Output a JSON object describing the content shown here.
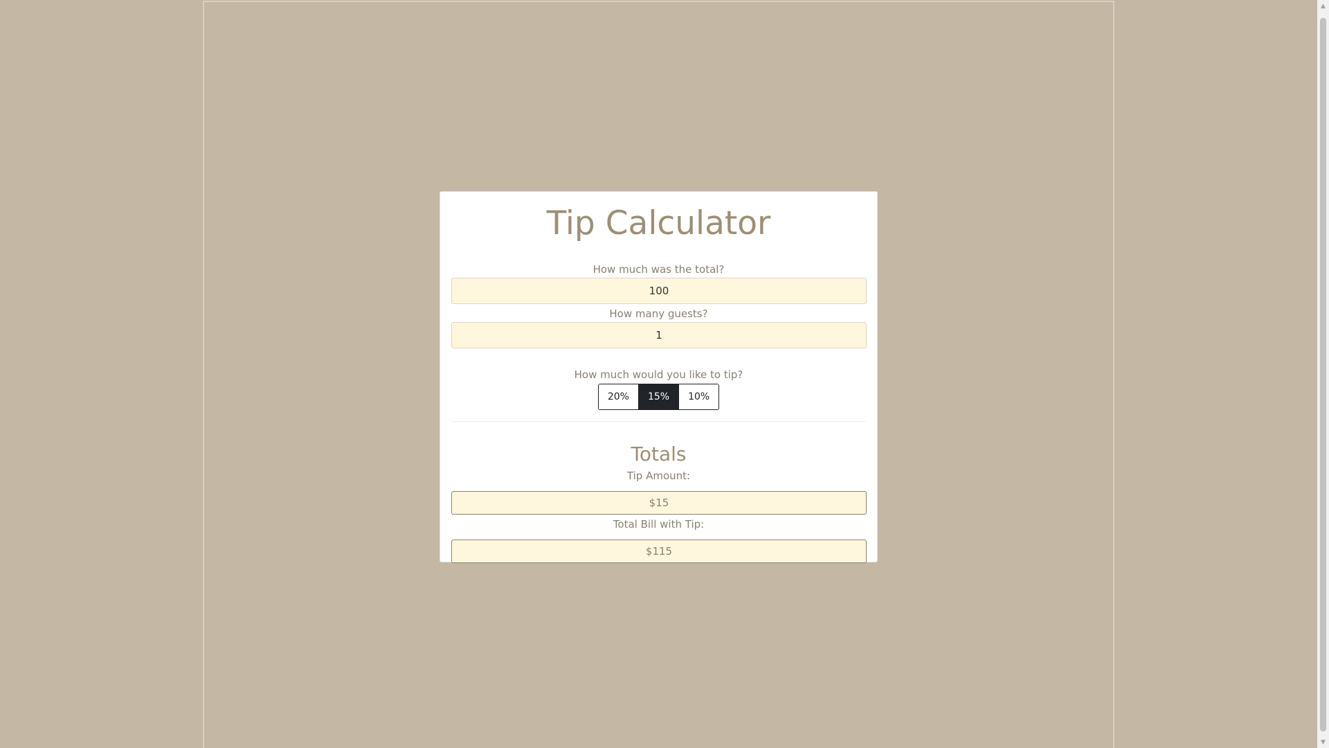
{
  "app": {
    "title": "Tip Calculator"
  },
  "form": {
    "total_label": "How much was the total?",
    "total_value": "100",
    "guests_label": "How many guests?",
    "guests_value": "1",
    "tip_label": "How much would you like to tip?",
    "tip_options": [
      "20%",
      "15%",
      "10%"
    ],
    "selected_tip": "15%"
  },
  "totals": {
    "heading": "Totals",
    "tip_amount_label": "Tip Amount:",
    "tip_amount_value": "$15",
    "total_bill_label": "Total Bill with Tip:",
    "total_bill_value": "$115"
  },
  "colors": {
    "background": "#c4b8a4",
    "accent_text": "#9c8f76",
    "field_background": "#fff7dd",
    "active_button": "#212529"
  }
}
